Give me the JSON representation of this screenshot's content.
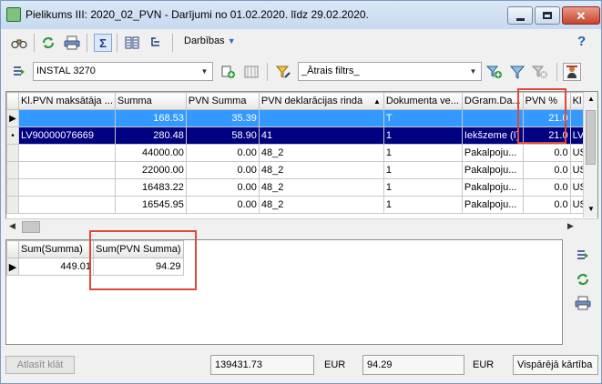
{
  "window": {
    "title": "Pielikums III: 2020_02_PVN - Darījumi no 01.02.2020. līdz 29.02.2020.",
    "min_label": "—",
    "close_label": "✕"
  },
  "toolbar": {
    "actions_label": "Darbības",
    "help_label": "?"
  },
  "filters": {
    "company_value": "INSTAL 3270",
    "quick_filter_value": "_Ātrais filtrs_"
  },
  "grid": {
    "columns": [
      "Kl.PVN maksātāja ...",
      "Summa",
      "PVN Summa",
      "PVN deklarācijas rinda",
      "Dokumenta ve...",
      "DGram.Da...",
      "PVN %",
      "Kl"
    ],
    "rows": [
      [
        "",
        "168.53",
        "35.39",
        "",
        "T",
        "",
        "21.0",
        ""
      ],
      [
        "LV90000076669",
        "280.48",
        "58.90",
        "41",
        "1",
        "Iekšzeme (I)",
        "21.0",
        "LV"
      ],
      [
        "",
        "44000.00",
        "0.00",
        "48_2",
        "1",
        "Pakalpoju...",
        "0.0",
        "US"
      ],
      [
        "",
        "22000.00",
        "0.00",
        "48_2",
        "1",
        "Pakalpoju...",
        "0.0",
        "US"
      ],
      [
        "",
        "16483.22",
        "0.00",
        "48_2",
        "1",
        "Pakalpoju...",
        "0.0",
        "US"
      ],
      [
        "",
        "16545.95",
        "0.00",
        "48_2",
        "1",
        "Pakalpoju...",
        "0.0",
        "US"
      ]
    ]
  },
  "summary": {
    "columns": [
      "Sum(Summa)",
      "Sum(PVN Summa)"
    ],
    "values": [
      "449.01",
      "94.29"
    ]
  },
  "status": {
    "clear_button": "Atlasīt klāt",
    "total_sum": "139431.73",
    "currency1": "EUR",
    "total_vat": "94.29",
    "currency2": "EUR",
    "order": "Vispārējā kārtība"
  },
  "colors": {
    "selection_light": "#3399ff",
    "selection_dark": "#000080",
    "highlight": "#e0483c"
  }
}
